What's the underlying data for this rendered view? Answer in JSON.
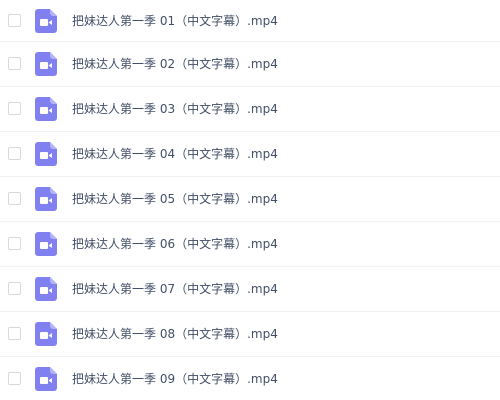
{
  "colors": {
    "icon_fill": "#8080f0",
    "icon_glyph": "#ffffff",
    "text": "#424e67"
  },
  "files": [
    {
      "name": "把妹达人第一季 01（中文字幕）.mp4",
      "icon": "video-file-icon"
    },
    {
      "name": "把妹达人第一季 02（中文字幕）.mp4",
      "icon": "video-file-icon"
    },
    {
      "name": "把妹达人第一季 03（中文字幕）.mp4",
      "icon": "video-file-icon"
    },
    {
      "name": "把妹达人第一季 04（中文字幕）.mp4",
      "icon": "video-file-icon"
    },
    {
      "name": "把妹达人第一季 05（中文字幕）.mp4",
      "icon": "video-file-icon"
    },
    {
      "name": "把妹达人第一季 06（中文字幕）.mp4",
      "icon": "video-file-icon"
    },
    {
      "name": "把妹达人第一季 07（中文字幕）.mp4",
      "icon": "video-file-icon"
    },
    {
      "name": "把妹达人第一季 08（中文字幕）.mp4",
      "icon": "video-file-icon"
    },
    {
      "name": "把妹达人第一季 09（中文字幕）.mp4",
      "icon": "video-file-icon"
    }
  ]
}
